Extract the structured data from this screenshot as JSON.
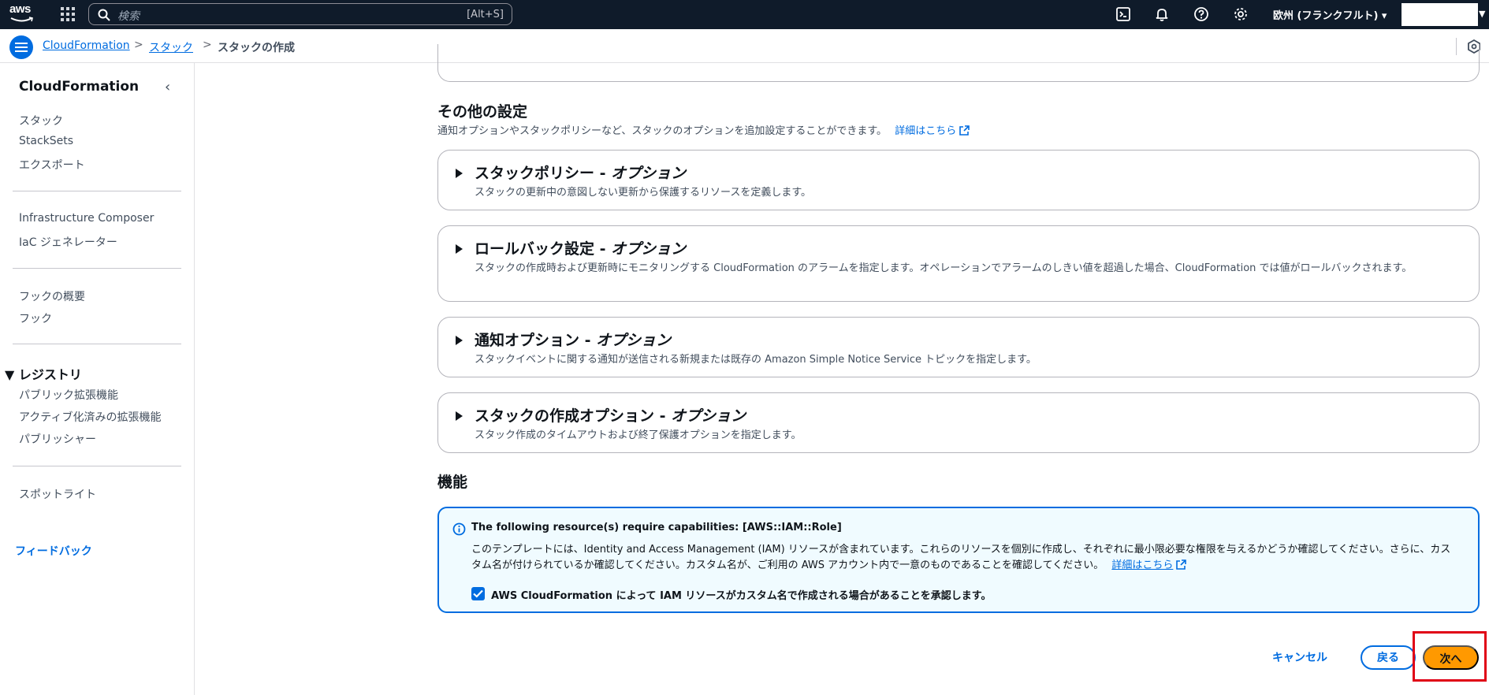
{
  "topnav": {
    "logo_text": "aws",
    "search_placeholder": "検索",
    "search_shortcut": "[Alt+S]",
    "region": "欧州 (フランクフルト) ▾",
    "icons": [
      "cloudshell-icon",
      "bell-icon",
      "help-icon",
      "gear-icon"
    ]
  },
  "breadcrumb": {
    "items": [
      "CloudFormation",
      "スタック",
      "スタックの作成"
    ],
    "separator": ">"
  },
  "sidebar": {
    "title": "CloudFormation",
    "group1": [
      "スタック",
      "StackSets",
      "エクスポート"
    ],
    "group2": [
      "Infrastructure Composer",
      "IaC ジェネレーター"
    ],
    "group3": [
      "フックの概要",
      "フック"
    ],
    "registry": {
      "title": "▼ レジストリ",
      "items": [
        "パブリック拡張機能",
        "アクティブ化済みの拡張機能",
        "パブリッシャー"
      ]
    },
    "spotlight": "スポットライト",
    "feedback": "フィードバック"
  },
  "main": {
    "other_settings": {
      "title": "その他の設定",
      "desc": "通知オプションやスタックポリシーなど、スタックのオプションを追加設定することができます。",
      "link": "詳細はこちら"
    },
    "expanders": [
      {
        "title": "スタックポリシー - ",
        "title_opt": "オプション",
        "desc": "スタックの更新中の意図しない更新から保護するリソースを定義します。"
      },
      {
        "title": "ロールバック設定 - ",
        "title_opt": "オプション",
        "desc": "スタックの作成時および更新時にモニタリングする CloudFormation のアラームを指定します。オペレーションでアラームのしきい値を超過した場合、CloudFormation では値がロールバックされます。"
      },
      {
        "title": "通知オプション - ",
        "title_opt": "オプション",
        "desc": "スタックイベントに関する通知が送信される新規または既存の Amazon Simple Notice Service トピックを指定します。"
      },
      {
        "title": "スタックの作成オプション - ",
        "title_opt": "オプション",
        "desc": "スタック作成のタイムアウトおよび終了保護オプションを指定します。"
      }
    ],
    "capabilities": {
      "title": "機能",
      "alert_title": "The following resource(s) require capabilities: [AWS::IAM::Role]",
      "alert_body": "このテンプレートには、Identity and Access Management (IAM) リソースが含まれています。これらのリソースを個別に作成し、それぞれに最小限必要な権限を与えるかどうか確認してください。さらに、カスタム名が付けられているか確認してください。カスタム名が、ご利用の AWS アカウント内で一意のものであることを確認してください。",
      "alert_link": "詳細はこちら",
      "ack_label": "AWS CloudFormation によって IAM リソースがカスタム名で作成される場合があることを承認します。",
      "ack_checked": true
    },
    "buttons": {
      "cancel": "キャンセル",
      "back": "戻る",
      "next": "次へ"
    }
  },
  "colors": {
    "nav_bg": "#0f1b2a",
    "link": "#006ce0",
    "primary": "#ff9900",
    "highlight": "#e00016"
  }
}
